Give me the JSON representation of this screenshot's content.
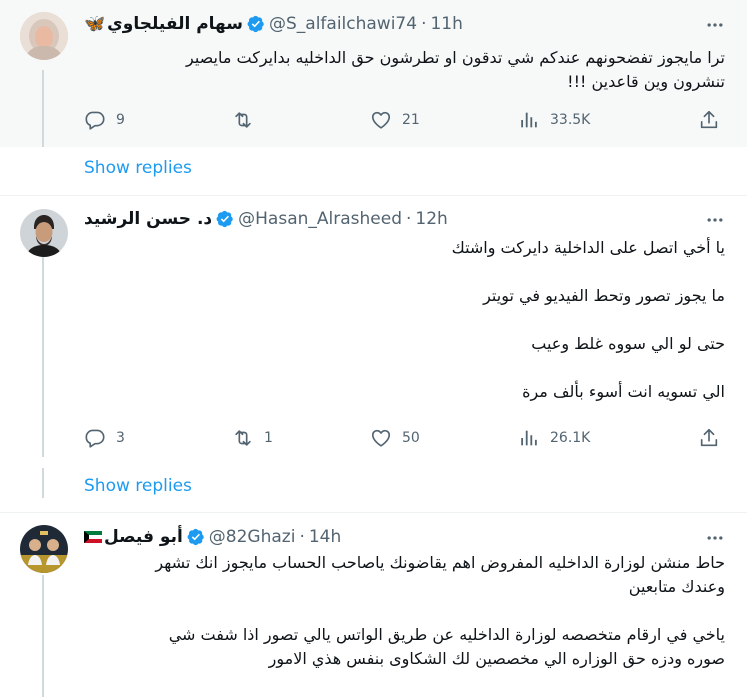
{
  "tweets": [
    {
      "name": "سهام الفيلجاوي",
      "emoji": "🦋",
      "handle": "@S_alfailchawi74",
      "time": "11h",
      "lines": [
        "ترا مايجوز تفضحونهم عندكم شي تدقون او تطرشون حق الداخليه بدايركت مايصير",
        "تنشرون وين قاعدين !!!"
      ],
      "stats": {
        "replies": "9",
        "retweets": "",
        "likes": "21",
        "views": "33.5K"
      }
    },
    {
      "name": "د. حسن الرشيد",
      "handle": "@Hasan_Alrasheed",
      "time": "12h",
      "lines": [
        "يا أخي اتصل على الداخلية دايركت واشتك",
        "ما يجوز تصور وتحط الفيديو في تويتر",
        "حتى لو الي سووه غلط وعيب",
        "الي تسويه انت أسوء بألف مرة"
      ],
      "stats": {
        "replies": "3",
        "retweets": "1",
        "likes": "50",
        "views": "26.1K"
      }
    },
    {
      "name": "أبو فيصل",
      "handle": "@82Ghazi",
      "time": "14h",
      "lines": [
        "حاط منشن لوزارة الداخليه المفروض اهم يقاضونك ياصاحب الحساب مايجوز انك تشهر",
        "وعندك متابعين",
        "ياخي في ارقام متخصصه لوزارة الداخليه عن طريق الواتس يالي تصور اذا شفت شي",
        "صوره ودزه حق الوزاره الي مخصصين لك الشكاوى بنفس هذي الامور"
      ]
    }
  ],
  "show_replies": "Show replies",
  "colors": {
    "accent": "#1d9bf0",
    "muted": "#536471",
    "text": "#0f1419",
    "verified": "#1d9bf0",
    "kuwait_green": "#007a3d",
    "kuwait_red": "#ce1126"
  },
  "icons": [
    "reply-icon",
    "retweet-icon",
    "like-icon",
    "views-icon",
    "share-icon",
    "more-icon",
    "verified-badge-icon",
    "butterfly-emoji",
    "kuwait-flag-emoji"
  ]
}
